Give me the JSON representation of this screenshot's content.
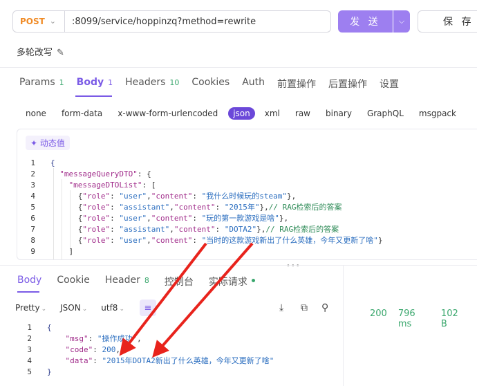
{
  "toolbar": {
    "method": "POST",
    "url": ":8099/service/hoppinzq?method=rewrite",
    "send_label": "发 送",
    "save_label": "保 存"
  },
  "request_name": "多轮改写",
  "request_tabs": [
    {
      "label": "Params",
      "count": "1"
    },
    {
      "label": "Body",
      "count": "1"
    },
    {
      "label": "Headers",
      "count": "10"
    },
    {
      "label": "Cookies",
      "count": ""
    },
    {
      "label": "Auth",
      "count": ""
    },
    {
      "label": "前置操作",
      "count": ""
    },
    {
      "label": "后置操作",
      "count": ""
    },
    {
      "label": "设置",
      "count": ""
    }
  ],
  "body_types": [
    "none",
    "form-data",
    "x-www-form-urlencoded",
    "json",
    "xml",
    "raw",
    "binary",
    "GraphQL",
    "msgpack"
  ],
  "dynamic_value_label": "动态值",
  "request_body": {
    "line_numbers": [
      "1",
      "2",
      "3",
      "4",
      "5",
      "6",
      "7",
      "8",
      "9"
    ],
    "lines": {
      "l1": "{",
      "l2_key": "\"messageQueryDTO\"",
      "l2_rest": ": {",
      "l3_key": "\"messageDTOList\"",
      "l3_rest": ": [",
      "l4_role_k": "\"role\"",
      "l4_role_v": "\"user\"",
      "l4_content_k": "\"content\"",
      "l4_content_v": "\"我什么时候玩的steam\"",
      "l5_role_k": "\"role\"",
      "l5_role_v": "\"assistant\"",
      "l5_content_k": "\"content\"",
      "l5_content_v": "\"2015年\"",
      "l5_comment": "// RAG检索后的答案",
      "l6_role_k": "\"role\"",
      "l6_role_v": "\"user\"",
      "l6_content_k": "\"content\"",
      "l6_content_v": "\"玩的第一款游戏是啥\"",
      "l7_role_k": "\"role\"",
      "l7_role_v": "\"assistant\"",
      "l7_content_k": "\"content\"",
      "l7_content_v": "\"DOTA2\"",
      "l7_comment": "// RAG检索后的答案",
      "l8_role_k": "\"role\"",
      "l8_role_v": "\"user\"",
      "l8_content_k": "\"content\"",
      "l8_content_v": "\"当时的这款游戏新出了什么英雄，今年又更新了啥\"",
      "l9": "]"
    }
  },
  "response_tabs": [
    {
      "label": "Body",
      "count": ""
    },
    {
      "label": "Cookie",
      "count": ""
    },
    {
      "label": "Header",
      "count": "8"
    },
    {
      "label": "控制台",
      "count": ""
    },
    {
      "label": "实际请求",
      "count": ""
    }
  ],
  "response_tools": {
    "format": "Pretty",
    "lang": "JSON",
    "encoding": "utf8"
  },
  "status": {
    "code": "200",
    "time": "796 ms",
    "size": "102 B"
  },
  "response_body": {
    "line_numbers": [
      "1",
      "2",
      "3",
      "4",
      "5"
    ],
    "l1": "{",
    "msg_k": "\"msg\"",
    "msg_v": "\"操作成功\"",
    "code_k": "\"code\"",
    "code_v": "200",
    "data_k": "\"data\"",
    "data_v": "\"2015年DOTA2新出了什么英雄，今年又更新了啥\"",
    "l5": "}"
  },
  "colors": {
    "accent": "#7b5be6",
    "send_button": "#9d7ff0",
    "method": "#f08a24",
    "success": "#3aa76d",
    "annotation_arrow": "#e8231c"
  }
}
